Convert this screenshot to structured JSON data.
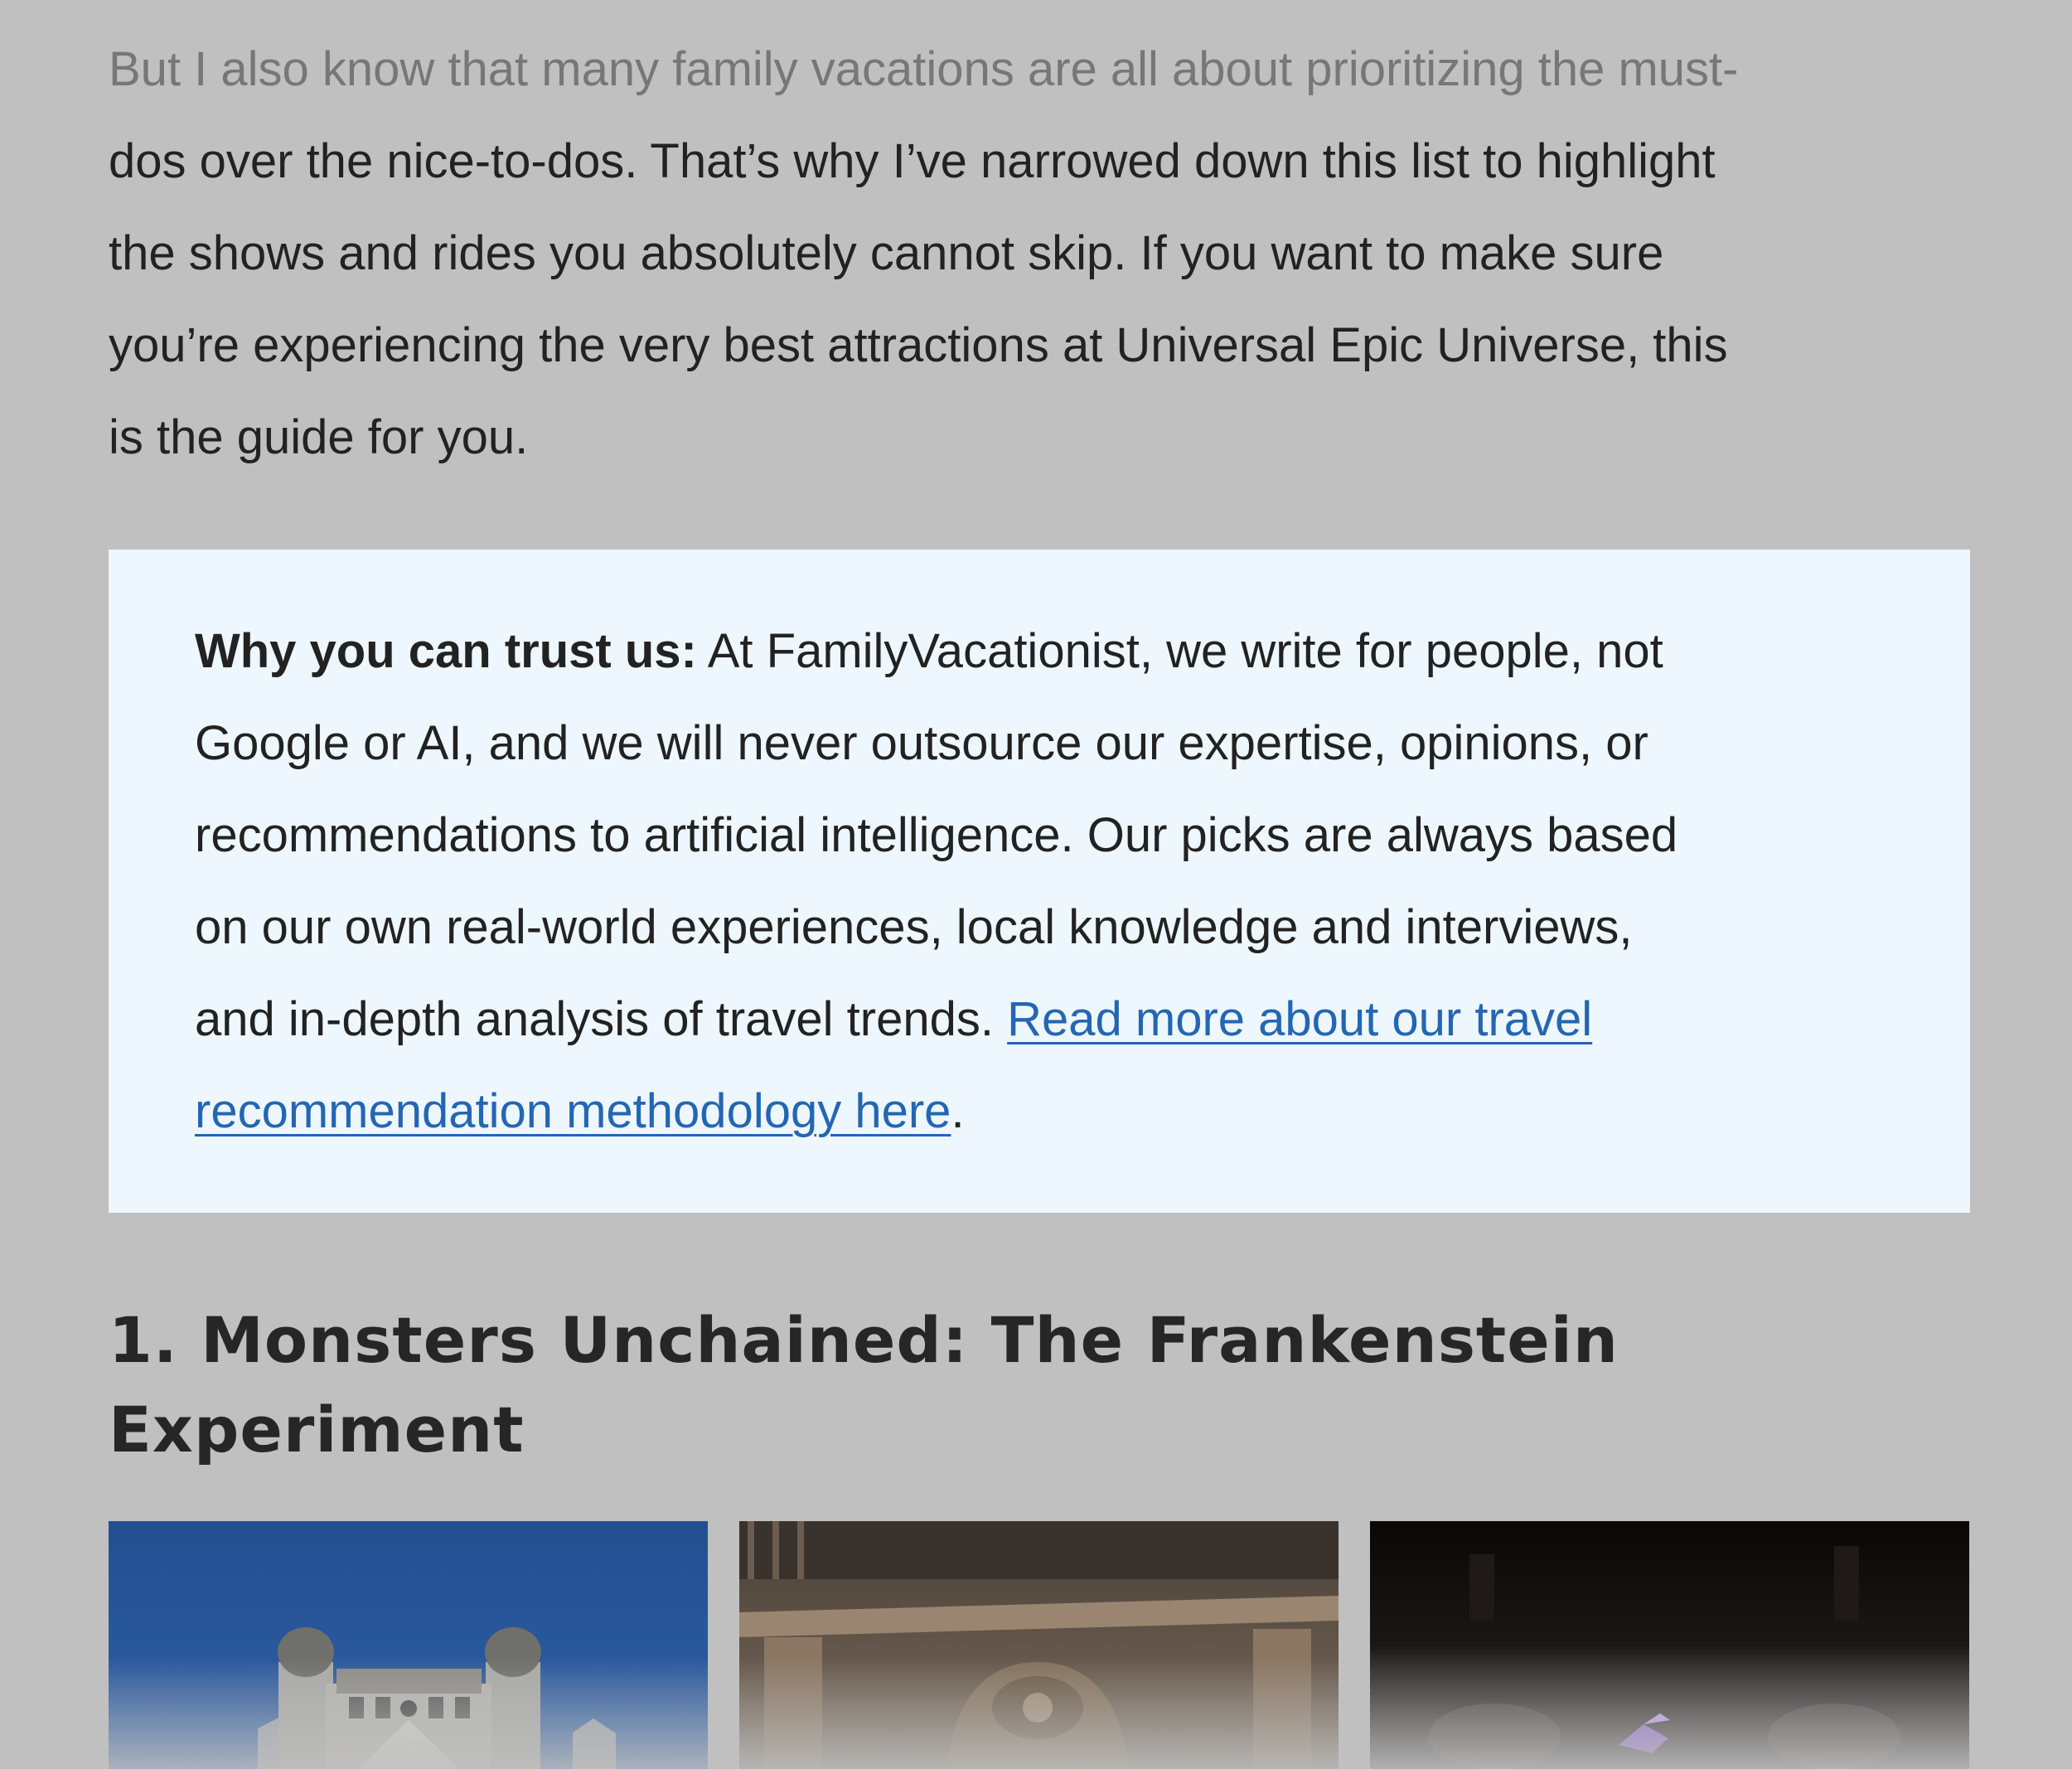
{
  "intro": {
    "lines": [
      "But I also know that many family vacations are all about prioritizing the must-",
      "dos over the nice-to-dos. That’s why I’ve narrowed down this list to highlight",
      "the shows and rides you absolutely cannot skip. If you want to make sure",
      "you’re experiencing the very best attractions at Universal Epic Universe, this",
      "is the guide for you."
    ]
  },
  "trust_box": {
    "label": "Why you can trust us:",
    "line1_rest": " At FamilyVacationist, we write for people, not",
    "line2": "Google or AI, and we will never outsource our expertise, opinions, or",
    "line3": "recommendations to artificial intelligence. Our picks are always based",
    "line4": "on our own real-world experiences, local knowledge and interviews,",
    "line5_text": "and in-depth analysis of travel trends. ",
    "link_part1": "Read more about our travel",
    "link_part2": "recommendation methodology here",
    "trailing": ".",
    "link_color": "#2366b3",
    "background": "#eef7fd"
  },
  "section": {
    "heading_line1": "1. Monsters Unchained: The Frankenstein",
    "heading_line2": "Experiment"
  },
  "gallery": {
    "images": [
      {
        "subject": "castle-tower-photo"
      },
      {
        "subject": "ornate-stone-facade-photo"
      },
      {
        "subject": "dark-ride-interior-photo"
      }
    ]
  },
  "colors": {
    "page_background": "#c0c0c0",
    "text": "#222222",
    "faded_text": "#777777"
  }
}
